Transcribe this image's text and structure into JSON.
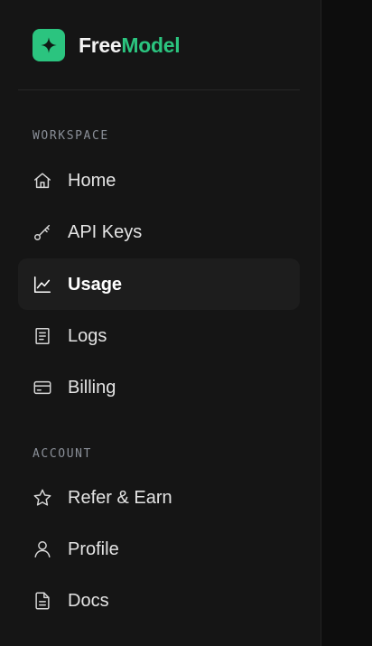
{
  "brand": {
    "name_part1": "Free",
    "name_part2": "Model",
    "logo_icon": "sparkle-icon",
    "accent_color": "#2bc47f"
  },
  "sections": {
    "workspace": {
      "label": "WORKSPACE",
      "items": [
        {
          "label": "Home",
          "icon": "home-icon",
          "active": false
        },
        {
          "label": "API Keys",
          "icon": "key-icon",
          "active": false
        },
        {
          "label": "Usage",
          "icon": "chart-line-icon",
          "active": true
        },
        {
          "label": "Logs",
          "icon": "document-list-icon",
          "active": false
        },
        {
          "label": "Billing",
          "icon": "credit-card-icon",
          "active": false
        }
      ]
    },
    "account": {
      "label": "ACCOUNT",
      "items": [
        {
          "label": "Refer & Earn",
          "icon": "star-icon",
          "active": false
        },
        {
          "label": "Profile",
          "icon": "user-icon",
          "active": false
        },
        {
          "label": "Docs",
          "icon": "docs-icon",
          "active": false
        }
      ]
    }
  }
}
